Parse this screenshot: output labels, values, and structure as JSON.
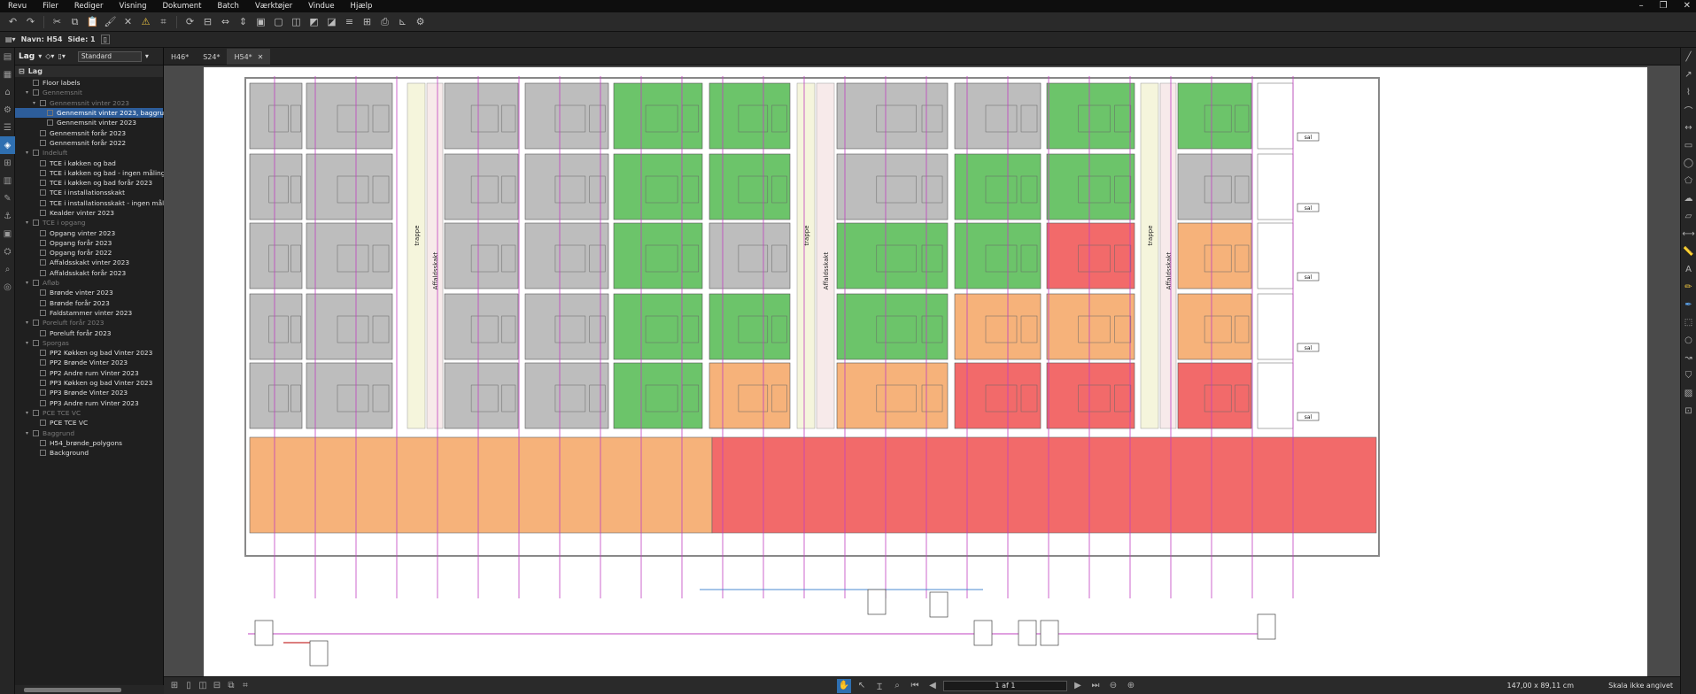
{
  "menubar": {
    "items": [
      "Revu",
      "Filer",
      "Rediger",
      "Visning",
      "Dokument",
      "Batch",
      "Værktøjer",
      "Vindue",
      "Hjælp"
    ]
  },
  "properties": {
    "name_label": "Navn: H54",
    "page_label": "Side: 1"
  },
  "layers_panel": {
    "title": "Lag",
    "preset": "Standard",
    "section": "Lag",
    "rows": [
      {
        "label": "Floor labels",
        "indent": 1,
        "dim": false
      },
      {
        "label": "Gennemsnit",
        "indent": 1,
        "dim": true
      },
      {
        "label": "Gennemsnit vinter 2023",
        "indent": 2,
        "dim": true
      },
      {
        "label": "Gennemsnit vinter 2023, baggrund i far",
        "indent": 3,
        "dim": false,
        "selected": true
      },
      {
        "label": "Gennemsnit vinter 2023",
        "indent": 3,
        "dim": false
      },
      {
        "label": "Gennemsnit forår 2023",
        "indent": 2,
        "dim": false
      },
      {
        "label": "Gennemsnit forår 2022",
        "indent": 2,
        "dim": false
      },
      {
        "label": "Indeluft",
        "indent": 1,
        "dim": true
      },
      {
        "label": "TCE i køkken og bad",
        "indent": 2,
        "dim": false
      },
      {
        "label": "TCE i køkken og bad - ingen målinger",
        "indent": 2,
        "dim": false
      },
      {
        "label": "TCE i køkken og bad forår 2023",
        "indent": 2,
        "dim": false
      },
      {
        "label": "TCE i installationsskakt",
        "indent": 2,
        "dim": false
      },
      {
        "label": "TCE i installationsskakt - ingen målinger",
        "indent": 2,
        "dim": false
      },
      {
        "label": "Kealder vinter 2023",
        "indent": 2,
        "dim": false
      },
      {
        "label": "TCE i opgang",
        "indent": 1,
        "dim": true
      },
      {
        "label": "Opgang vinter 2023",
        "indent": 2,
        "dim": false
      },
      {
        "label": "Opgang forår 2023",
        "indent": 2,
        "dim": false
      },
      {
        "label": "Opgang forår 2022",
        "indent": 2,
        "dim": false
      },
      {
        "label": "Affaldsskakt vinter 2023",
        "indent": 2,
        "dim": false
      },
      {
        "label": "Affaldsskakt forår 2023",
        "indent": 2,
        "dim": false
      },
      {
        "label": "Afløb",
        "indent": 1,
        "dim": true
      },
      {
        "label": "Brønde vinter 2023",
        "indent": 2,
        "dim": false
      },
      {
        "label": "Brønde forår 2023",
        "indent": 2,
        "dim": false
      },
      {
        "label": "Faldstammer vinter 2023",
        "indent": 2,
        "dim": false
      },
      {
        "label": "Poreluft forår 2023",
        "indent": 1,
        "dim": true
      },
      {
        "label": "Poreluft forår 2023",
        "indent": 2,
        "dim": false
      },
      {
        "label": "Sporgas",
        "indent": 1,
        "dim": true
      },
      {
        "label": "PP2 Køkken og bad Vinter 2023",
        "indent": 2,
        "dim": false
      },
      {
        "label": "PP2 Brønde Vinter 2023",
        "indent": 2,
        "dim": false
      },
      {
        "label": "PP2 Andre rum Vinter 2023",
        "indent": 2,
        "dim": false
      },
      {
        "label": "PP3 Køkken og bad Vinter 2023",
        "indent": 2,
        "dim": false
      },
      {
        "label": "PP3 Brønde Vinter 2023",
        "indent": 2,
        "dim": false
      },
      {
        "label": "PP3 Andre rum Vinter 2023",
        "indent": 2,
        "dim": false
      },
      {
        "label": "PCE TCE VC",
        "indent": 1,
        "dim": true
      },
      {
        "label": "PCE TCE VC",
        "indent": 2,
        "dim": false
      },
      {
        "label": "Baggrund",
        "indent": 1,
        "dim": true
      },
      {
        "label": "H54_brønde_polygons",
        "indent": 2,
        "dim": false
      },
      {
        "label": "Background",
        "indent": 2,
        "dim": false
      }
    ]
  },
  "tabs": [
    {
      "label": "H46*",
      "active": false
    },
    {
      "label": "S24*",
      "active": false
    },
    {
      "label": "H54*",
      "active": true
    }
  ],
  "drawing": {
    "stair_labels": [
      "trappe",
      "trappe",
      "trappe"
    ],
    "shaft_labels": [
      "Affaldsskakt",
      "Affaldsskakt",
      "Affaldsskakt"
    ],
    "floor_tags": [
      "sal",
      "sal",
      "sal",
      "sal",
      "sal"
    ],
    "colors": {
      "gray": "#bdbdbd",
      "green": "#6cc46a",
      "orange": "#f6b27a",
      "red": "#f26a6a"
    },
    "grid": [
      [
        "g",
        "g",
        "g",
        "g",
        "G",
        "G",
        "g",
        "g",
        "G",
        "G"
      ],
      [
        "g",
        "g",
        "g",
        "g",
        "G",
        "G",
        "g",
        "G",
        "G",
        "g"
      ],
      [
        "g",
        "g",
        "g",
        "g",
        "G",
        "g",
        "G",
        "G",
        "R",
        "O"
      ],
      [
        "g",
        "g",
        "g",
        "g",
        "G",
        "G",
        "G",
        "O",
        "O",
        "O"
      ],
      [
        "g",
        "g",
        "g",
        "g",
        "G",
        "O",
        "O",
        "R",
        "R",
        "R"
      ]
    ]
  },
  "status": {
    "page": "1 af 1",
    "dimensions": "147,00 x 89,11 cm",
    "scale": "Skala ikke angivet"
  }
}
